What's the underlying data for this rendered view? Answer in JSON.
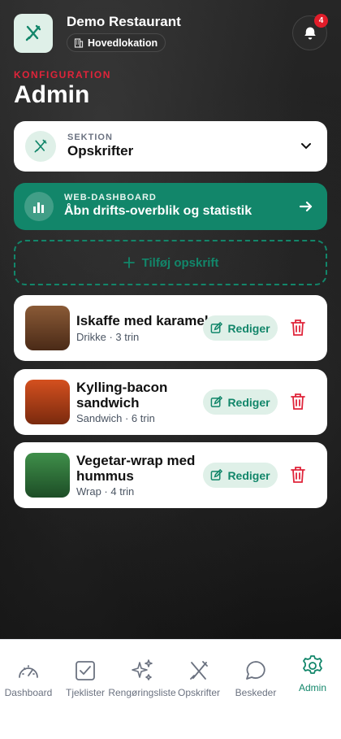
{
  "header": {
    "restaurant_name": "Demo Restaurant",
    "location": "Hovedlokation",
    "notification_count": "4"
  },
  "page": {
    "eyebrow": "KONFIGURATION",
    "title": "Admin"
  },
  "section_selector": {
    "kicker": "SEKTION",
    "value": "Opskrifter"
  },
  "web_dashboard": {
    "kicker": "WEB-DASHBOARD",
    "text": "Åbn drifts-overblik og statistik"
  },
  "add_recipe": "Tilføj opskrift",
  "recipes": [
    {
      "title": "Iskaffe med karamel",
      "subtitle": "Drikke · 3 trin",
      "color_top": "#8a5a36",
      "color_bottom": "#4a2a17",
      "edit_label": "Rediger"
    },
    {
      "title": "Kylling-bacon sandwich",
      "subtitle": "Sandwich · 6 trin",
      "color_top": "#d4501f",
      "color_bottom": "#7a2a0e",
      "edit_label": "Rediger"
    },
    {
      "title": "Vegetar-wrap med hummus",
      "subtitle": "Wrap · 4 trin",
      "color_top": "#3f8f4a",
      "color_bottom": "#1d4d26",
      "edit_label": "Rediger"
    }
  ],
  "tabs": [
    {
      "label": "Dashboard",
      "icon": "gauge-icon",
      "active": false
    },
    {
      "label": "Tjeklister",
      "icon": "checklist-icon",
      "active": false
    },
    {
      "label": "Rengøringsliste",
      "icon": "sparkles-icon",
      "active": false
    },
    {
      "label": "Opskrifter",
      "icon": "utensils-icon",
      "active": false
    },
    {
      "label": "Beskeder",
      "icon": "chat-icon",
      "active": false
    },
    {
      "label": "Admin",
      "icon": "gear-icon",
      "active": true
    }
  ],
  "colors": {
    "accent": "#12866a",
    "accent_light": "#dff0e8",
    "danger": "#e0243a"
  }
}
